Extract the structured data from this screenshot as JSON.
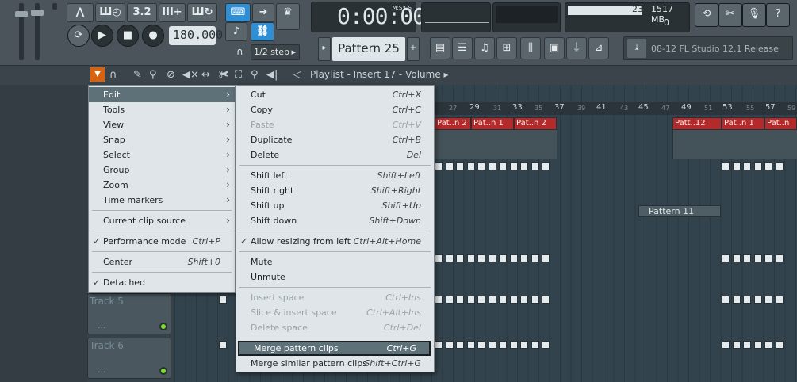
{
  "toolbar": {
    "tempo": "180.000",
    "time_display": "0:00:00",
    "time_format": "M:S:CS",
    "pattern": "Pattern 25",
    "snap_step": "1/2 step",
    "cpu_value": "23",
    "memory": "1517 MB",
    "polyphony": "0",
    "news": "08-12  FL Studio 12.1 Release",
    "mode_buttons": [
      "3.2",
      "III+"
    ]
  },
  "playlist": {
    "title": "Playlist - Insert 17 - Volume",
    "ruler": [
      "29",
      "33",
      "37",
      "41",
      "45",
      "49",
      "53",
      "57"
    ],
    "ruler_small": [
      "27",
      "31",
      "35",
      "39",
      "43",
      "47",
      "51",
      "55",
      "59"
    ],
    "tracks": [
      "Track 5",
      "Track 6"
    ],
    "clips_red": [
      "Pat..n 2",
      "Pat..n 1",
      "Pat..n 2",
      "Patt..12",
      "Pat..n 1",
      "Pat..n"
    ],
    "pattern11": "Pattern 11"
  },
  "main_menu": {
    "items": [
      {
        "label": "Edit",
        "shortcut": ""
      },
      {
        "label": "Tools",
        "shortcut": ""
      },
      {
        "label": "View",
        "shortcut": ""
      },
      {
        "label": "Snap",
        "shortcut": ""
      },
      {
        "label": "Select",
        "shortcut": ""
      },
      {
        "label": "Group",
        "shortcut": ""
      },
      {
        "label": "Zoom",
        "shortcut": ""
      },
      {
        "label": "Time markers",
        "shortcut": ""
      },
      {
        "label": "Current clip source",
        "shortcut": ""
      },
      {
        "label": "Performance mode",
        "shortcut": "Ctrl+P"
      },
      {
        "label": "Center",
        "shortcut": "Shift+0"
      },
      {
        "label": "Detached",
        "shortcut": ""
      }
    ]
  },
  "edit_menu": {
    "items": [
      {
        "label": "Cut",
        "shortcut": "Ctrl+X"
      },
      {
        "label": "Copy",
        "shortcut": "Ctrl+C"
      },
      {
        "label": "Paste",
        "shortcut": "Ctrl+V"
      },
      {
        "label": "Duplicate",
        "shortcut": "Ctrl+B"
      },
      {
        "label": "Delete",
        "shortcut": "Del"
      },
      {
        "label": "Shift left",
        "shortcut": "Shift+Left"
      },
      {
        "label": "Shift right",
        "shortcut": "Shift+Right"
      },
      {
        "label": "Shift up",
        "shortcut": "Shift+Up"
      },
      {
        "label": "Shift down",
        "shortcut": "Shift+Down"
      },
      {
        "label": "Allow resizing from left",
        "shortcut": "Ctrl+Alt+Home"
      },
      {
        "label": "Mute",
        "shortcut": ""
      },
      {
        "label": "Unmute",
        "shortcut": ""
      },
      {
        "label": "Insert space",
        "shortcut": "Ctrl+Ins"
      },
      {
        "label": "Slice & insert space",
        "shortcut": "Ctrl+Alt+Ins"
      },
      {
        "label": "Delete space",
        "shortcut": "Ctrl+Del"
      },
      {
        "label": "Merge pattern clips",
        "shortcut": "Ctrl+G"
      },
      {
        "label": "Merge similar pattern clips",
        "shortcut": "Shift+Ctrl+G"
      }
    ]
  }
}
